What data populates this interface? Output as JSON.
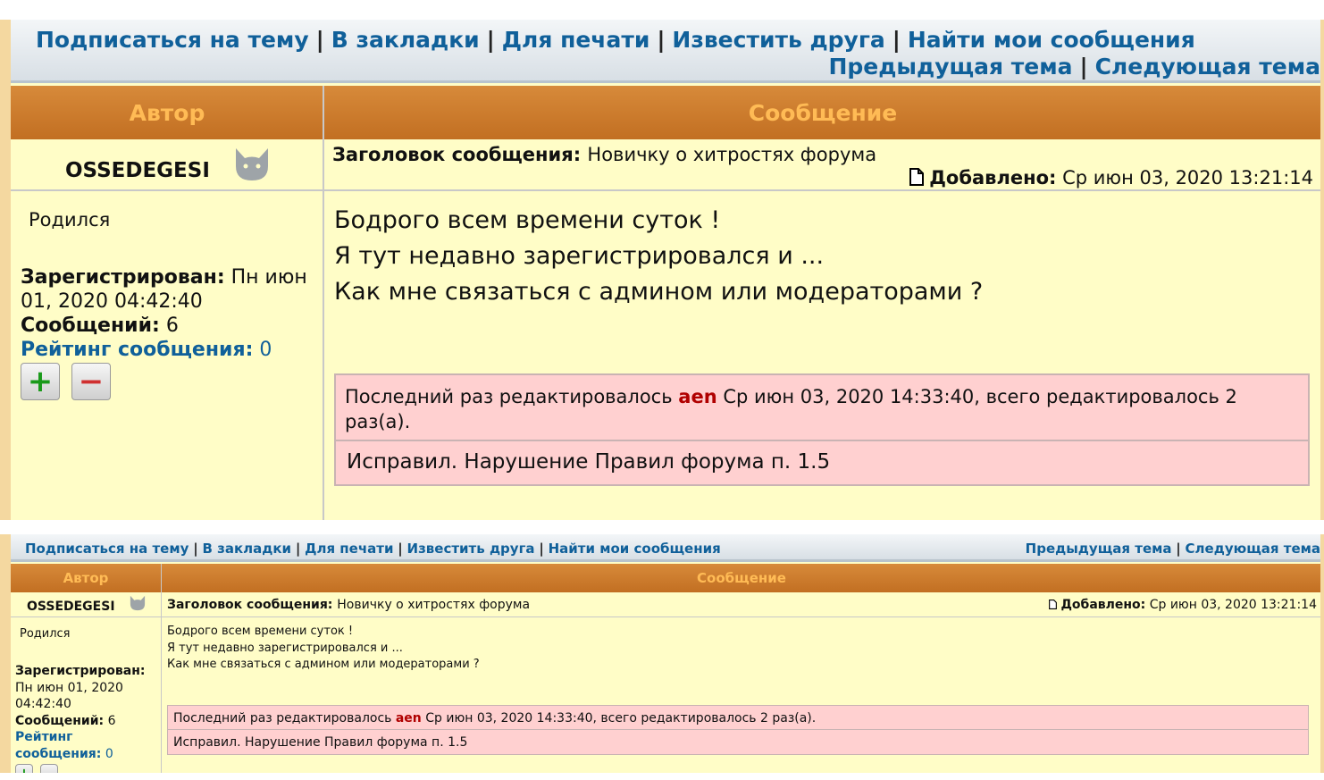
{
  "nav": {
    "subscribe": "Подписаться на тему",
    "bookmarks": "В закладки",
    "print": "Для печати",
    "notify": "Известить друга",
    "find_my": "Найти мои сообщения",
    "prev_topic": "Предыдущая тема",
    "next_topic": "Следующая тема",
    "separator": "|"
  },
  "table_headers": {
    "author": "Автор",
    "message": "Сообщение"
  },
  "post": {
    "author": "OSSEDEGESI",
    "avatar_icon": "cat-icon",
    "born_label": "Родился",
    "registered_label": "Зарегистрирован:",
    "registered_value": "Пн июн 01, 2020 04:42:40",
    "registered_value_l1": "Пн июн",
    "registered_value_l2": "01, 2020 04:42:40",
    "registered_value_s1": "Пн июн 01, 2020",
    "registered_value_s2": "04:42:40",
    "posts_label": "Сообщений:",
    "posts_value": "6",
    "rating_label": "Рейтинг сообщения:",
    "rating_label_s1": "Рейтинг",
    "rating_label_s2": "сообщения:",
    "rating_value": "0",
    "rate_up": "+",
    "rate_down": "−",
    "subject_label": "Заголовок сообщения:",
    "subject_value": "Новичку о хитростях форума",
    "added_label": "Добавлено:",
    "added_value": "Ср июн 03, 2020 13:21:14",
    "body_lines": [
      "Бодрого всем времени суток !",
      "Я тут недавно зарегистрировался и ...",
      "Как мне связаться с админом или модераторами ?"
    ],
    "edit_prefix": "Последний раз редактировалось",
    "edit_user": "aen",
    "edit_suffix": "Ср июн 03, 2020 14:33:40, всего редактировалось 2 раз(а).",
    "edit_suffix_l1": "Ср июн 03, 2020 14:33:40, всего редактировалось 2",
    "edit_suffix_l2": "раз(а).",
    "edit_reason": "Исправил. Нарушение Правил форума п. 1.5"
  },
  "colors": {
    "link": "#10609a",
    "header_bg": "#c87728",
    "header_text": "#ffbb55",
    "post_bg": "#fffdc7",
    "edit_bg": "#ffd0d0",
    "editor_name": "#b00000"
  }
}
